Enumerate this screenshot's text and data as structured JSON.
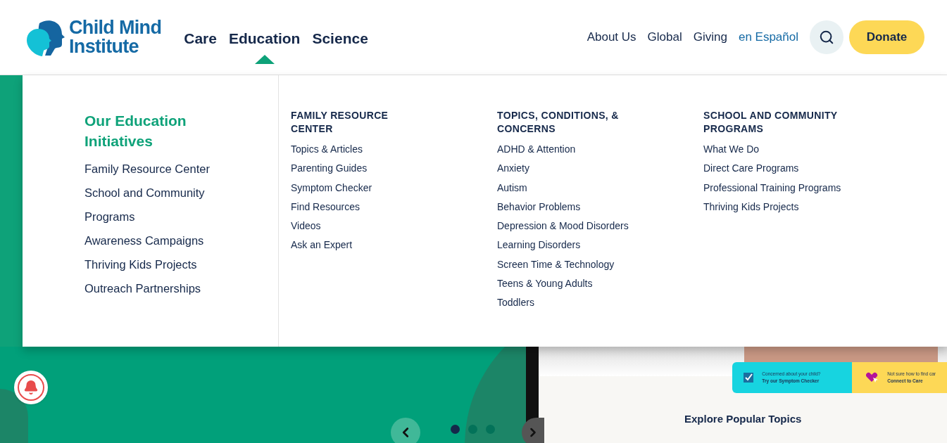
{
  "logo": {
    "line_1": "Child Mind",
    "line_2": "Institute"
  },
  "main_nav": [
    {
      "label": "Care",
      "selected": false
    },
    {
      "label": "Education",
      "selected": true
    },
    {
      "label": "Science",
      "selected": false
    }
  ],
  "utility_nav": [
    "About Us",
    "Global",
    "Giving",
    "en Español"
  ],
  "donate_button": "Donate",
  "menu": {
    "heading": "Our Education Initiatives",
    "initiatives": [
      "Family Resource Center",
      "School and Community Programs",
      "Awareness Campaigns",
      "Thriving Kids Projects",
      "Outreach Partnerships"
    ],
    "columns": [
      {
        "title": "FAMILY RESOURCE CENTER",
        "links": [
          "Topics & Articles",
          "Parenting Guides",
          "Symptom Checker",
          "Find Resources",
          "Videos",
          "Ask an Expert"
        ]
      },
      {
        "title": "TOPICS, CONDITIONS, & CONCERNS",
        "links": [
          "ADHD & Attention",
          "Anxiety",
          "Autism",
          "Behavior Problems",
          "Depression & Mood Disorders",
          "Learning Disorders",
          "Screen Time & Technology",
          "Teens & Young Adults",
          "Toddlers"
        ]
      },
      {
        "title": "SCHOOL AND COMMUNITY PROGRAMS",
        "links": [
          "What We Do",
          "Direct Care Programs",
          "Professional Training Programs",
          "Thriving Kids Projects"
        ]
      }
    ]
  },
  "carousel": {
    "dots": [
      {
        "selected": true
      },
      {
        "selected": false
      },
      {
        "selected": false
      }
    ]
  },
  "slide": {
    "cards": [
      {
        "kind": "check",
        "line_1": "Concerned about your child?",
        "line_2": "Try our Symptom Checker"
      },
      {
        "kind": "heart",
        "line_1": "Not sure how to find car",
        "line_2": "Connect to Care"
      }
    ],
    "heading": "Explore Popular Topics"
  }
}
